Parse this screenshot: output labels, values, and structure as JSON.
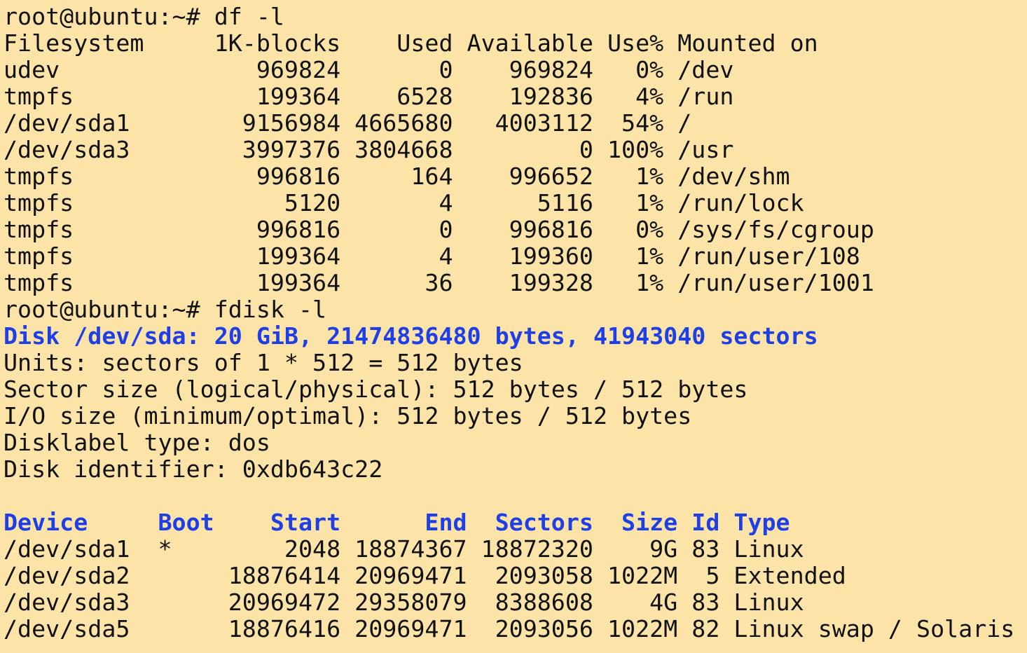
{
  "window": {
    "background": "#fce4a8",
    "text_color": "#111111",
    "accent_color": "#1f3fe6"
  },
  "terminal": {
    "lines": [
      {
        "text": "root@ubuntu:~# df -l",
        "style": "prompt"
      },
      {
        "text": "Filesystem     1K-blocks    Used Available Use% Mounted on",
        "style": "output"
      },
      {
        "text": "udev              969824       0    969824   0% /dev",
        "style": "output"
      },
      {
        "text": "tmpfs             199364    6528    192836   4% /run",
        "style": "output"
      },
      {
        "text": "/dev/sda1        9156984 4665680   4003112  54% /",
        "style": "output"
      },
      {
        "text": "/dev/sda3        3997376 3804668         0 100% /usr",
        "style": "output"
      },
      {
        "text": "tmpfs             996816     164    996652   1% /dev/shm",
        "style": "output"
      },
      {
        "text": "tmpfs               5120       4      5116   1% /run/lock",
        "style": "output"
      },
      {
        "text": "tmpfs             996816       0    996816   0% /sys/fs/cgroup",
        "style": "output"
      },
      {
        "text": "tmpfs             199364       4    199360   1% /run/user/108",
        "style": "output"
      },
      {
        "text": "tmpfs             199364      36    199328   1% /run/user/1001",
        "style": "output"
      },
      {
        "text": "root@ubuntu:~# fdisk -l",
        "style": "prompt"
      },
      {
        "text": "Disk /dev/sda: 20 GiB, 21474836480 bytes, 41943040 sectors",
        "style": "highlight"
      },
      {
        "text": "Units: sectors of 1 * 512 = 512 bytes",
        "style": "output"
      },
      {
        "text": "Sector size (logical/physical): 512 bytes / 512 bytes",
        "style": "output"
      },
      {
        "text": "I/O size (minimum/optimal): 512 bytes / 512 bytes",
        "style": "output"
      },
      {
        "text": "Disklabel type: dos",
        "style": "output"
      },
      {
        "text": "Disk identifier: 0xdb643c22",
        "style": "output"
      },
      {
        "text": "",
        "style": "output"
      },
      {
        "text": "Device     Boot    Start      End  Sectors  Size Id Type",
        "style": "highlight"
      },
      {
        "text": "/dev/sda1  *        2048 18874367 18872320    9G 83 Linux",
        "style": "output"
      },
      {
        "text": "/dev/sda2       18876414 20969471  2093058 1022M  5 Extended",
        "style": "output"
      },
      {
        "text": "/dev/sda3       20969472 29358079  8388608    4G 83 Linux",
        "style": "output"
      },
      {
        "text": "/dev/sda5       18876416 20969471  2093056 1022M 82 Linux swap / Solaris",
        "style": "output"
      }
    ]
  }
}
